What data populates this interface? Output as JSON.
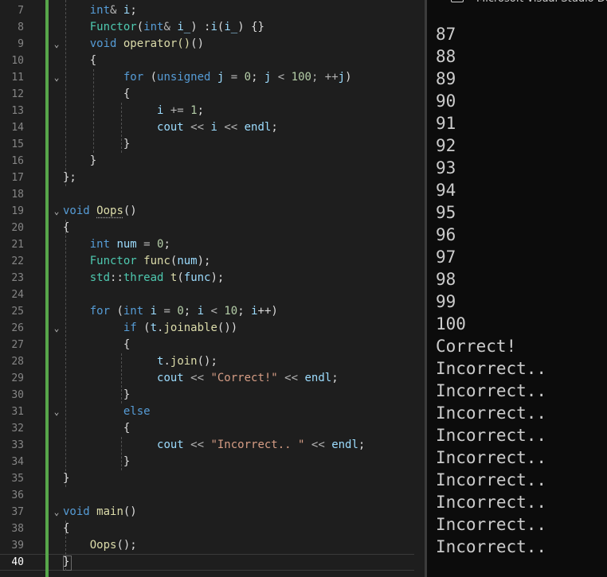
{
  "editor": {
    "line_numbers": [
      "7",
      "8",
      "9",
      "10",
      "11",
      "12",
      "13",
      "14",
      "15",
      "16",
      "17",
      "18",
      "19",
      "20",
      "21",
      "22",
      "23",
      "24",
      "25",
      "26",
      "27",
      "28",
      "29",
      "30",
      "31",
      "32",
      "33",
      "34",
      "35",
      "36",
      "37",
      "38",
      "39",
      "40"
    ],
    "active_line": "40"
  },
  "code": {
    "l7": {
      "a": "int",
      "b": "& ",
      "c": "i",
      "d": ";"
    },
    "l8": {
      "a": "Functor",
      "b": "(",
      "c": "int",
      "d": "& ",
      "e": "i_",
      "f": ") :",
      "g": "i",
      "h": "(",
      "i": "i_",
      "j": ") {}"
    },
    "l9": {
      "a": "void",
      "b": " ",
      "c": "operator()",
      "d": "()"
    },
    "l10": {
      "a": "{"
    },
    "l11": {
      "a": "for",
      "b": " (",
      "c": "unsigned",
      "d": " ",
      "e": "j",
      "f": " = ",
      "g": "0",
      "h": "; ",
      "i": "j",
      "j": " < ",
      "k": "100",
      "l": "; ++",
      "m": "j",
      "n": ")"
    },
    "l12": {
      "a": "{"
    },
    "l13": {
      "a": "i",
      "b": " += ",
      "c": "1",
      "d": ";"
    },
    "l14": {
      "a": "cout",
      "b": " << ",
      "c": "i",
      "d": " << ",
      "e": "endl",
      "f": ";"
    },
    "l15": {
      "a": "}"
    },
    "l16": {
      "a": "}"
    },
    "l17": {
      "a": "};"
    },
    "l19": {
      "a": "void",
      "b": " ",
      "c": "Oops",
      "d": "()"
    },
    "l20": {
      "a": "{"
    },
    "l21": {
      "a": "int",
      "b": " ",
      "c": "num",
      "d": " = ",
      "e": "0",
      "f": ";"
    },
    "l22": {
      "a": "Functor",
      "b": " ",
      "c": "func",
      "d": "(",
      "e": "num",
      "f": ");"
    },
    "l23": {
      "a": "std",
      "b": "::",
      "c": "thread",
      "d": " ",
      "e": "t",
      "f": "(",
      "g": "func",
      "h": ");"
    },
    "l25": {
      "a": "for",
      "b": " (",
      "c": "int",
      "d": " ",
      "e": "i",
      "f": " = ",
      "g": "0",
      "h": "; ",
      "i": "i",
      "j": " < ",
      "k": "10",
      "l": "; ",
      "m": "i",
      "n": "++)"
    },
    "l26": {
      "a": "if",
      "b": " (",
      "c": "t",
      "d": ".",
      "e": "joinable",
      "f": "())"
    },
    "l27": {
      "a": "{"
    },
    "l28": {
      "a": "t",
      "b": ".",
      "c": "join",
      "d": "();"
    },
    "l29": {
      "a": "cout",
      "b": " << ",
      "c": "\"Correct!\"",
      "d": " << ",
      "e": "endl",
      "f": ";"
    },
    "l30": {
      "a": "}"
    },
    "l31": {
      "a": "else"
    },
    "l32": {
      "a": "{"
    },
    "l33": {
      "a": "cout",
      "b": " << ",
      "c": "\"Incorrect.. \"",
      "d": " << ",
      "e": "endl",
      "f": ";"
    },
    "l34": {
      "a": "}"
    },
    "l35": {
      "a": "}"
    },
    "l37": {
      "a": "void",
      "b": " ",
      "c": "main",
      "d": "()"
    },
    "l38": {
      "a": "{"
    },
    "l39": {
      "a": "Oops",
      "b": "();"
    },
    "l40": {
      "a": "}"
    }
  },
  "console": {
    "title": "Microsoft Visual Studio Debug Console",
    "lines": [
      "87",
      "88",
      "89",
      "90",
      "91",
      "92",
      "93",
      "94",
      "95",
      "96",
      "97",
      "98",
      "99",
      "100",
      "Correct!",
      "Incorrect..",
      "Incorrect..",
      "Incorrect..",
      "Incorrect..",
      "Incorrect..",
      "Incorrect..",
      "Incorrect..",
      "Incorrect..",
      "Incorrect.."
    ]
  },
  "colors": {
    "editor_bg": "#1e1e1e",
    "console_bg": "#0c0c0c",
    "keyword": "#569cd6",
    "type": "#4ec9b0",
    "function": "#dcdcaa",
    "string": "#d69d85",
    "number": "#b5cea8",
    "change_bar": "#57a64a"
  },
  "icons": [
    "fold-chevron-icon",
    "console-window-icon"
  ]
}
